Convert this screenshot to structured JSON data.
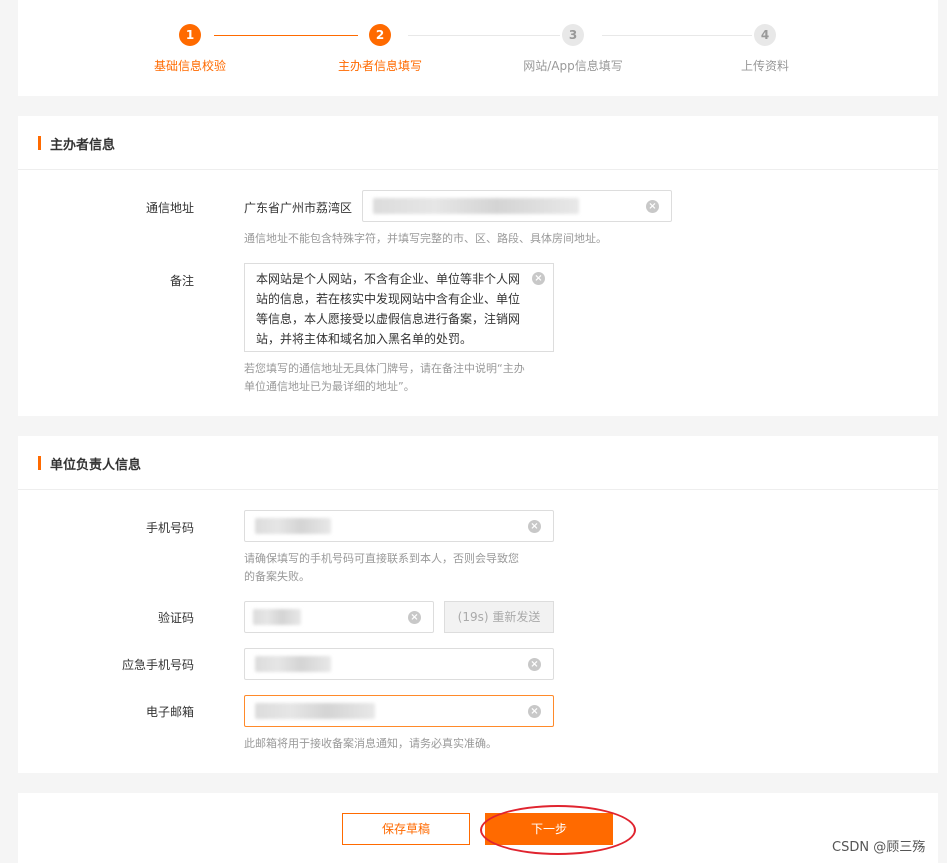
{
  "stepper": {
    "steps": [
      {
        "num": "1",
        "label": "基础信息校验",
        "state": "active"
      },
      {
        "num": "2",
        "label": "主办者信息填写",
        "state": "active"
      },
      {
        "num": "3",
        "label": "网站/App信息填写",
        "state": "inactive"
      },
      {
        "num": "4",
        "label": "上传资料",
        "state": "inactive"
      }
    ]
  },
  "sponsor": {
    "title": "主办者信息",
    "address": {
      "label": "通信地址",
      "prefix": "广东省广州市荔湾区",
      "hint": "通信地址不能包含特殊字符，并填写完整的市、区、路段、具体房间地址。"
    },
    "remark": {
      "label": "备注",
      "value": "本网站是个人网站，不含有企业、单位等非个人网站的信息，若在核实中发现网站中含有企业、单位等信息，本人愿接受以虚假信息进行备案，注销网站，并将主体和域名加入黑名单的处罚。",
      "hint_line1": "若您填写的通信地址无具体门牌号，请在备注中说明“主办",
      "hint_line2": "单位通信地址已为最详细的地址”。"
    }
  },
  "principal": {
    "title": "单位负责人信息",
    "phone": {
      "label": "手机号码",
      "hint_line1": "请确保填写的手机号码可直接联系到本人，否则会导致您",
      "hint_line2": "的备案失败。"
    },
    "code": {
      "label": "验证码",
      "resend_label": "(19s) 重新发送"
    },
    "emergency_phone": {
      "label": "应急手机号码"
    },
    "email": {
      "label": "电子邮箱",
      "hint": "此邮箱将用于接收备案消息通知，请务必真实准确。"
    }
  },
  "actions": {
    "save_draft": "保存草稿",
    "next": "下一步"
  },
  "watermark": "CSDN @顾三殇",
  "colors": {
    "accent": "#ff6a00",
    "annotation": "#e0242f"
  },
  "icons": {
    "clear": "clear-icon"
  }
}
